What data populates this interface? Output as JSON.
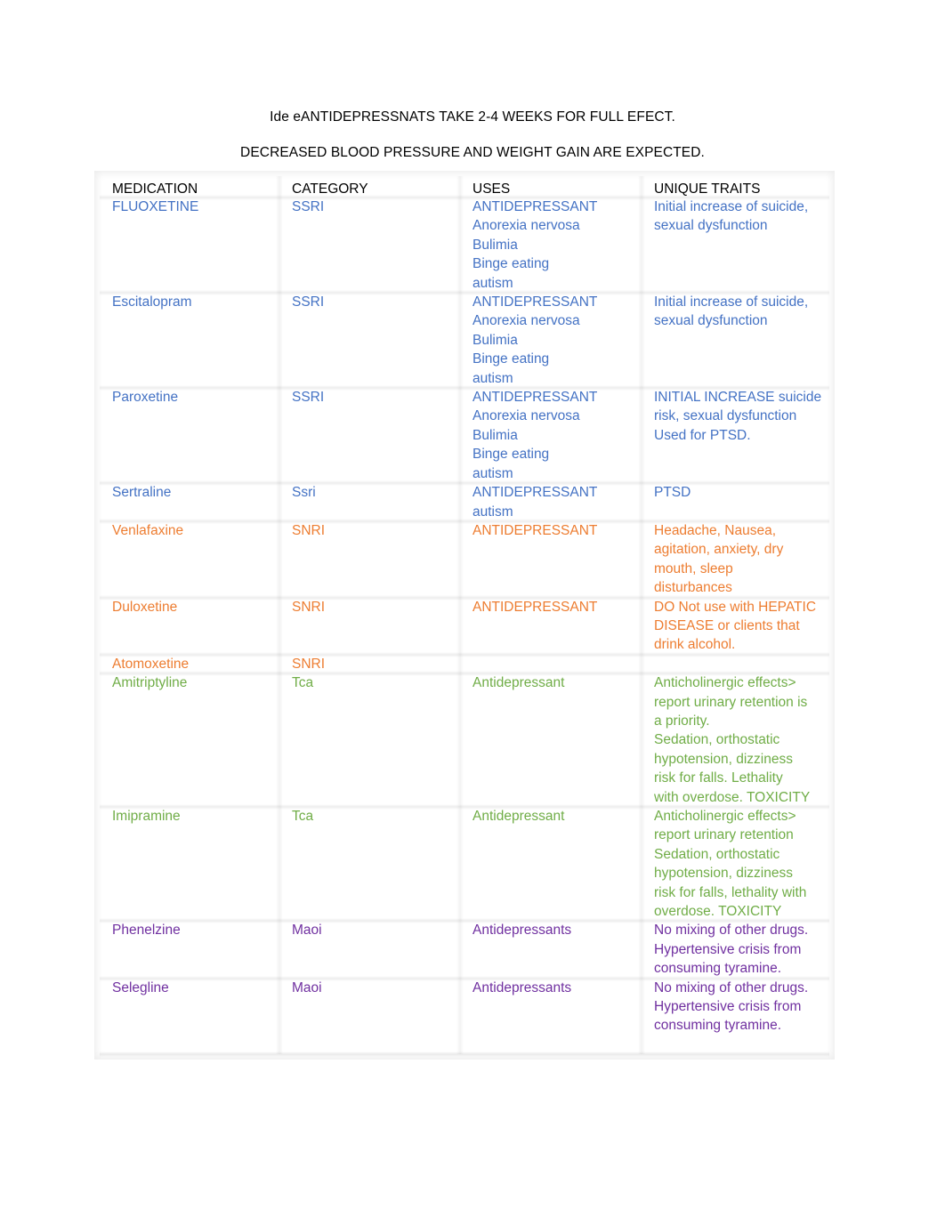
{
  "document": {
    "title_line1": "Ide eANTIDEPRESSNATS TAKE 2-4 WEEKS FOR FULL EFECT.",
    "title_line2": "DECREASED BLOOD PRESSURE AND WEIGHT GAIN ARE EXPECTED."
  },
  "colors": {
    "header": "#000000",
    "ssri": "#4472c4",
    "snri": "#ed7d31",
    "tca": "#70ad47",
    "maoi": "#7030a0"
  },
  "table": {
    "headers": [
      "MEDICATION",
      "CATEGORY",
      "USES",
      "UNIQUE TRAITS"
    ],
    "rows": [
      {
        "group": "ssri",
        "medication": "FLUOXETINE",
        "category": "SSRI",
        "uses": [
          "ANTIDEPRESSANT",
          "Anorexia nervosa",
          "Bulimia",
          "Binge eating",
          "autism"
        ],
        "traits": [
          "Initial increase of suicide,",
          "sexual dysfunction"
        ]
      },
      {
        "group": "ssri",
        "medication": "Escitalopram",
        "category": "SSRI",
        "uses": [
          "ANTIDEPRESSANT",
          "Anorexia nervosa",
          "Bulimia",
          "Binge eating",
          "autism"
        ],
        "traits": [
          "Initial increase of suicide,",
          "sexual dysfunction"
        ]
      },
      {
        "group": "ssri",
        "medication": "Paroxetine",
        "category": "SSRI",
        "uses": [
          "ANTIDEPRESSANT",
          "Anorexia nervosa",
          "Bulimia",
          "Binge eating",
          "autism"
        ],
        "traits": [
          "INITIAL INCREASE suicide",
          "risk, sexual dysfunction",
          "Used for PTSD."
        ]
      },
      {
        "group": "ssri",
        "medication": "Sertraline",
        "category": "Ssri",
        "uses": [
          "ANTIDEPRESSANT",
          "autism"
        ],
        "traits": [
          "PTSD"
        ]
      },
      {
        "group": "snri",
        "medication": "Venlafaxine",
        "category": "SNRI",
        "uses": [
          "ANTIDEPRESSANT"
        ],
        "traits": [
          "Headache, Nausea,",
          "agitation, anxiety, dry",
          "mouth, sleep",
          "disturbances"
        ]
      },
      {
        "group": "snri",
        "medication": "Duloxetine",
        "category": "SNRI",
        "uses": [
          "ANTIDEPRESSANT"
        ],
        "traits": [
          "DO Not use with HEPATIC",
          "DISEASE or clients that",
          "drink alcohol."
        ]
      },
      {
        "group": "snri",
        "medication": "Atomoxetine",
        "category": "SNRI",
        "uses": [],
        "traits": []
      },
      {
        "group": "tca",
        "medication": "Amitriptyline",
        "category": "Tca",
        "uses": [
          "Antidepressant"
        ],
        "traits": [
          "Anticholinergic effects>",
          "report urinary retention is",
          "a priority.",
          "Sedation, orthostatic",
          "hypotension, dizziness",
          "risk for falls. Lethality",
          "with overdose. TOXICITY"
        ]
      },
      {
        "group": "tca",
        "medication": "Imipramine",
        "category": "Tca",
        "uses": [
          "Antidepressant"
        ],
        "traits": [
          "Anticholinergic effects>",
          "report urinary retention",
          "Sedation, orthostatic",
          "hypotension, dizziness",
          "risk for falls, lethality with",
          "overdose. TOXICITY"
        ]
      },
      {
        "group": "maoi",
        "medication": "Phenelzine",
        "category": "Maoi",
        "uses": [
          "Antidepressants"
        ],
        "traits": [
          "No mixing of other drugs.",
          "Hypertensive crisis from",
          "consuming tyramine."
        ]
      },
      {
        "group": "maoi",
        "medication": "Selegline",
        "category": "Maoi",
        "uses": [
          "Antidepressants"
        ],
        "traits": [
          "No mixing of other drugs.",
          "Hypertensive crisis from",
          "consuming tyramine.",
          ""
        ]
      }
    ]
  }
}
